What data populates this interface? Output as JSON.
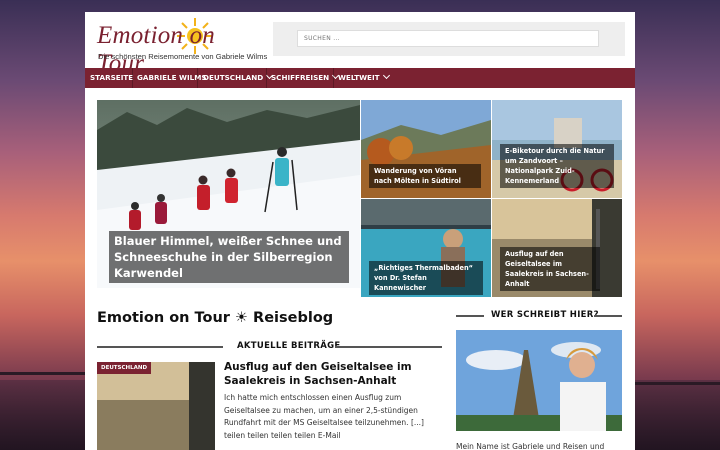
{
  "logo": {
    "title": "Emotion on Tour",
    "subtitle": "Die schönsten Reisemomente von Gabriele Wilms"
  },
  "search": {
    "placeholder": "SUCHEN ..."
  },
  "nav": [
    {
      "label": "STARSEITE",
      "dropdown": false
    },
    {
      "label": "GABRIELE WILMS",
      "dropdown": false
    },
    {
      "label": "DEUTSCHLAND",
      "dropdown": true
    },
    {
      "label": "SCHIFFREISEN",
      "dropdown": true
    },
    {
      "label": "WELTWEIT",
      "dropdown": true
    }
  ],
  "featured": [
    {
      "title": "Blauer Himmel, weißer Schnee und Schneeschuhe in der Silberregion Karwendel"
    },
    {
      "title": "Wanderung von Vöran nach Mölten in Südtirol"
    },
    {
      "title": "E-Biketour durch die Natur um Zandvoort – Nationalpark Zuid-Kennemerland"
    },
    {
      "title": "„Richtiges Thermalbaden“ von Dr. Stefan Kannewischer"
    },
    {
      "title": "Ausflug auf den Geiseltalsee im Saalekreis in Sachsen-Anhalt"
    }
  ],
  "main": {
    "title": "Emotion on Tour ☀ Reiseblog",
    "recent_heading": "AKTUELLE BEITRÄGE",
    "post": {
      "category": "DEUTSCHLAND",
      "title": "Ausflug auf den Geiseltalsee im Saalekreis in Sachsen-Anhalt",
      "excerpt": "Ich hatte mich entschlossen einen Ausflug zum Geiseltalsee zu machen, um an einer 2,5-stündigen Rundfahrt mit der MS Geiseltalsee teilzunehmen. [...] teilen teilen teilen teilen E-Mail"
    }
  },
  "sidebar": {
    "heading": "WER SCHREIBT HIER?",
    "author_text": "Mein Name ist Gabriele und Reisen und"
  },
  "colors": {
    "brand": "#7b2231",
    "header_bg": "#ffffff",
    "search_bg": "#eeeeee"
  }
}
